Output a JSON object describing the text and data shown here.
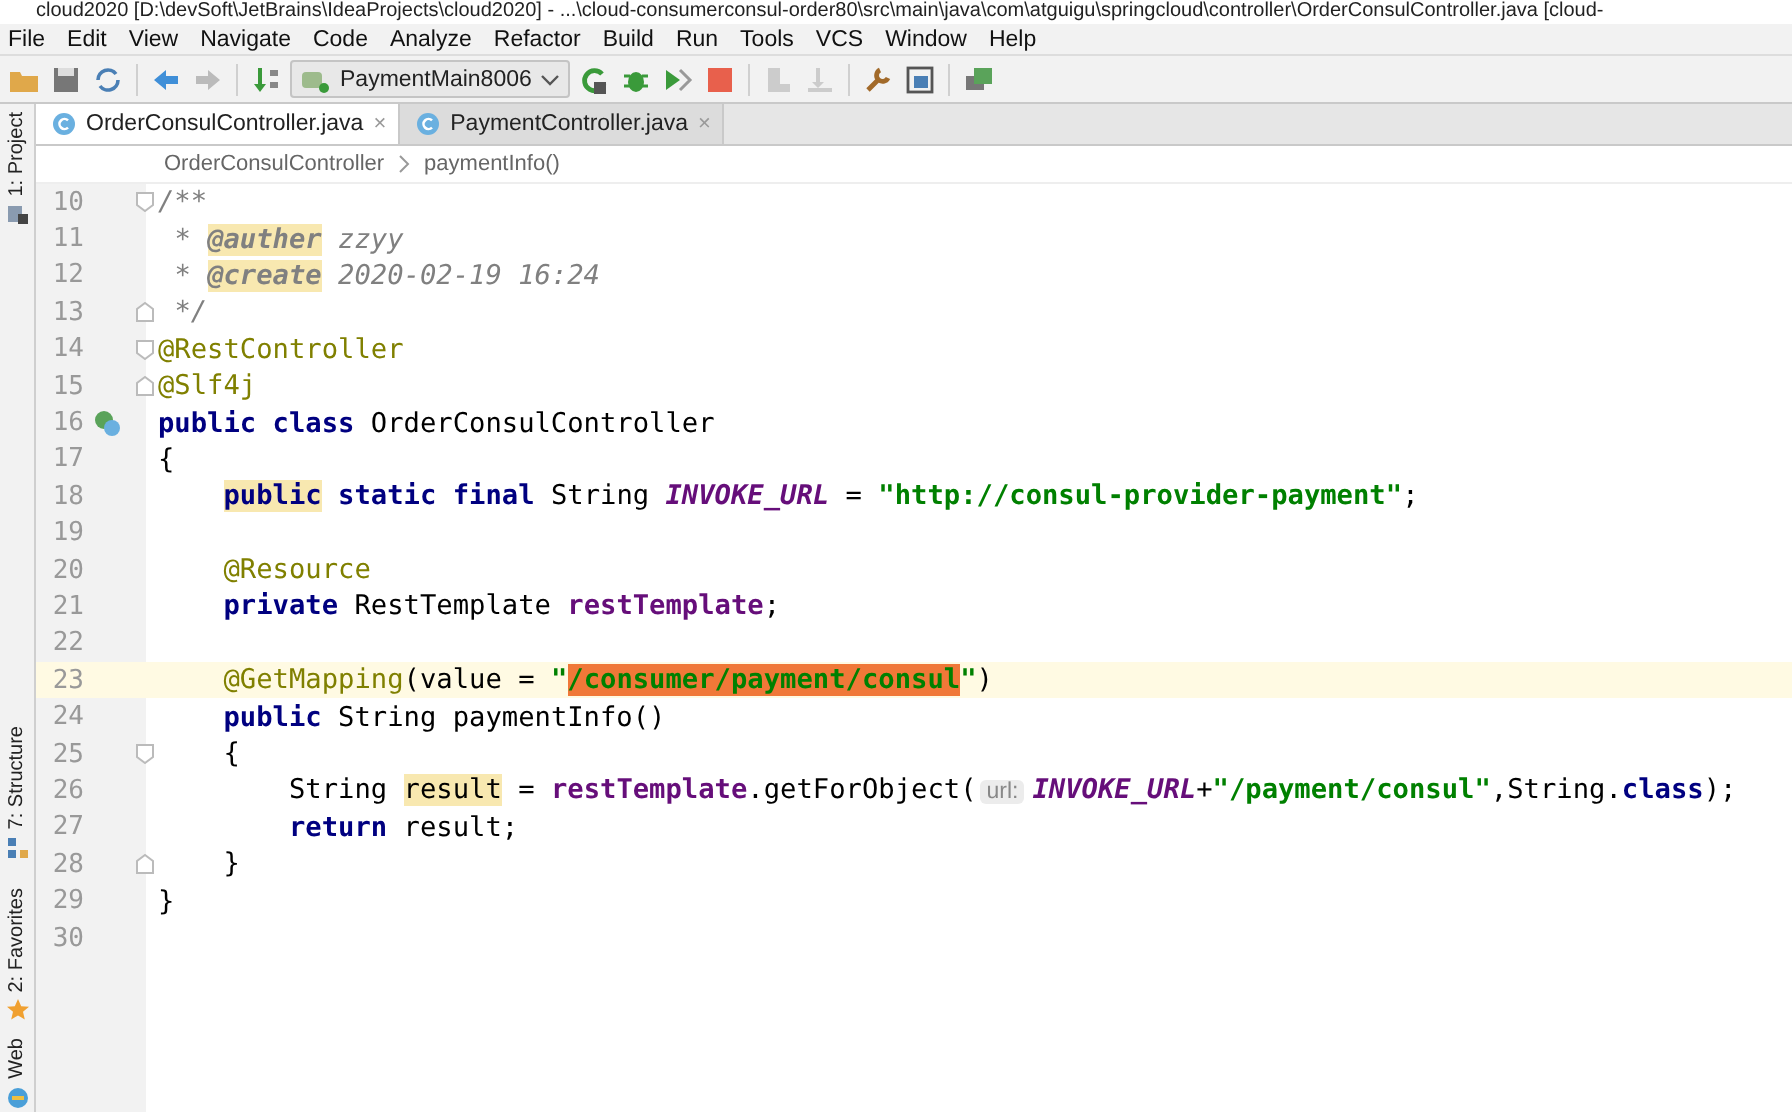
{
  "window": {
    "title": "cloud2020 [D:\\devSoft\\JetBrains\\IdeaProjects\\cloud2020] - ...\\cloud-consumerconsul-order80\\src\\main\\java\\com\\atguigu\\springcloud\\controller\\OrderConsulController.java [cloud-"
  },
  "menu": [
    "File",
    "Edit",
    "View",
    "Navigate",
    "Code",
    "Analyze",
    "Refactor",
    "Build",
    "Run",
    "Tools",
    "VCS",
    "Window",
    "Help"
  ],
  "toolbar": [
    {
      "kind": "folder"
    },
    {
      "kind": "save"
    },
    {
      "kind": "sync"
    },
    {
      "kind": "sep"
    },
    {
      "kind": "back"
    },
    {
      "kind": "forward",
      "disabled": true
    },
    {
      "kind": "sep"
    },
    {
      "kind": "build"
    },
    {
      "kind": "run-config",
      "label": "PaymentMain8006"
    },
    {
      "kind": "rerun"
    },
    {
      "kind": "debug"
    },
    {
      "kind": "coverage"
    },
    {
      "kind": "stop"
    },
    {
      "kind": "sep"
    },
    {
      "kind": "deploy",
      "disabled": true
    },
    {
      "kind": "deploy-down",
      "disabled": true
    },
    {
      "kind": "sep"
    },
    {
      "kind": "wrench"
    },
    {
      "kind": "structure"
    },
    {
      "kind": "sep"
    },
    {
      "kind": "vcs"
    }
  ],
  "tool_strip": [
    {
      "label": "1: Project",
      "kind": "project"
    },
    {
      "label": "7: Structure",
      "kind": "structure"
    },
    {
      "label": "2: Favorites",
      "kind": "star"
    },
    {
      "label": "Web",
      "kind": "web"
    }
  ],
  "tabs": [
    {
      "label": "OrderConsulController.java",
      "close": "×",
      "selected": true
    },
    {
      "label": "PaymentController.java",
      "close": "×",
      "selected": false
    }
  ],
  "breadcrumb": [
    "OrderConsulController",
    "paymentInfo()"
  ],
  "code": [
    {
      "n": "10",
      "kind": "fold-start",
      "tokens": [
        {
          "text": "/**",
          "kind": "comment"
        }
      ]
    },
    {
      "n": "11",
      "tokens": [
        {
          "text": " * ",
          "kind": "comment"
        },
        {
          "text": "@auther",
          "kind": "doc-tag",
          "highlighted": true
        },
        {
          "text": " zzyy",
          "kind": "comment"
        }
      ]
    },
    {
      "n": "12",
      "tokens": [
        {
          "text": " * ",
          "kind": "comment"
        },
        {
          "text": "@create",
          "kind": "doc-tag",
          "highlighted": true
        },
        {
          "text": " 2020-02-19 16:24",
          "kind": "comment"
        }
      ]
    },
    {
      "n": "13",
      "kind": "fold-end",
      "tokens": [
        {
          "text": " */",
          "kind": "comment"
        }
      ]
    },
    {
      "n": "14",
      "kind": "fold-start",
      "tokens": [
        {
          "text": "@RestController",
          "kind": "annotation"
        }
      ]
    },
    {
      "n": "15",
      "kind": "fold-end",
      "tokens": [
        {
          "text": "@Slf4j",
          "kind": "annotation"
        }
      ]
    },
    {
      "n": "16",
      "kind": "bean",
      "tokens": [
        {
          "text": "public",
          "kind": "keyword"
        },
        {
          "text": " class",
          "kind": "keyword"
        },
        {
          "text": " OrderConsulController",
          "kind": "plain"
        }
      ]
    },
    {
      "n": "17",
      "tokens": [
        {
          "text": "{",
          "kind": "plain"
        }
      ]
    },
    {
      "n": "18",
      "tokens": [
        {
          "text": "    public",
          "kind": "keyword",
          "highlighted": true
        },
        {
          "text": " static final",
          "kind": "keyword"
        },
        {
          "text": " String ",
          "kind": "plain"
        },
        {
          "text": "INVOKE_URL",
          "kind": "constant"
        },
        {
          "text": " = ",
          "kind": "plain"
        },
        {
          "text": "\"http://consul-provider-payment\"",
          "kind": "string"
        },
        {
          "text": ";",
          "kind": "plain"
        }
      ]
    },
    {
      "n": "19"
    },
    {
      "n": "20",
      "tokens": [
        {
          "text": "    @Resource",
          "kind": "annotation"
        }
      ]
    },
    {
      "n": "21",
      "tokens": [
        {
          "text": "    private",
          "kind": "keyword"
        },
        {
          "text": " RestTemplate ",
          "kind": "plain"
        },
        {
          "text": "restTemplate",
          "kind": "field"
        },
        {
          "text": ";",
          "kind": "plain"
        }
      ]
    },
    {
      "n": "22"
    },
    {
      "n": "23",
      "current": true,
      "tokens": [
        {
          "text": "    @GetMapping",
          "kind": "annotation"
        },
        {
          "text": "(value = ",
          "kind": "plain"
        },
        {
          "text": "\"",
          "kind": "string"
        },
        {
          "text": "/consumer/payment/consul",
          "kind": "string",
          "selected": true
        },
        {
          "text": "\"",
          "kind": "string"
        },
        {
          "text": ")",
          "kind": "plain"
        }
      ]
    },
    {
      "n": "24",
      "tokens": [
        {
          "text": "    public",
          "kind": "keyword"
        },
        {
          "text": " String paymentInfo()",
          "kind": "plain"
        }
      ]
    },
    {
      "n": "25",
      "kind": "fold-start",
      "tokens": [
        {
          "text": "    {",
          "kind": "plain"
        }
      ]
    },
    {
      "n": "26",
      "tokens": [
        {
          "text": "        String ",
          "kind": "plain"
        },
        {
          "text": "result",
          "kind": "plain",
          "highlighted": true
        },
        {
          "text": " = ",
          "kind": "plain"
        },
        {
          "text": "restTemplate",
          "kind": "field"
        },
        {
          "text": ".getForObject(",
          "kind": "plain"
        },
        {
          "text": "url:",
          "kind": "hint"
        },
        {
          "text": "INVOKE_URL",
          "kind": "constant"
        },
        {
          "text": "+",
          "kind": "plain"
        },
        {
          "text": "\"/payment/consul\"",
          "kind": "string"
        },
        {
          "text": ",String.",
          "kind": "plain"
        },
        {
          "text": "class",
          "kind": "keyword"
        },
        {
          "text": ");",
          "kind": "plain"
        }
      ]
    },
    {
      "n": "27",
      "tokens": [
        {
          "text": "        return",
          "kind": "keyword"
        },
        {
          "text": " result;",
          "kind": "plain"
        }
      ]
    },
    {
      "n": "28",
      "kind": "fold-end",
      "tokens": [
        {
          "text": "    }",
          "kind": "plain"
        }
      ]
    },
    {
      "n": "29",
      "tokens": [
        {
          "text": "}",
          "kind": "plain"
        }
      ]
    },
    {
      "n": "30"
    }
  ]
}
